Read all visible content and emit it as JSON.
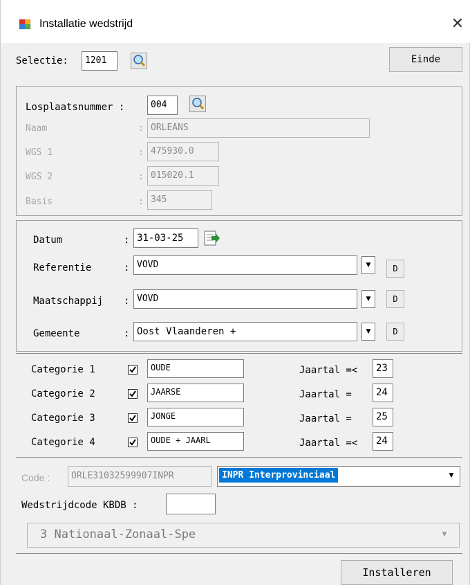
{
  "window": {
    "title": "Installatie wedstrijd",
    "close_glyph": "✕"
  },
  "top": {
    "selectie_label": "Selectie:",
    "selectie_value": "1201",
    "einde_label": "Einde"
  },
  "losplaats": {
    "nummer_label": "Losplaatsnummer :",
    "nummer_value": "004",
    "naam_label": "Naam",
    "naam_value": "ORLEANS",
    "wgs1_label": "WGS 1",
    "wgs1_value": "475930.0",
    "wgs2_label": "WGS 2",
    "wgs2_value": "015020.1",
    "basis_label": "Basis",
    "basis_value": "345",
    "colon": ":"
  },
  "details": {
    "datum_label": "Datum",
    "datum_value": "31-03-25",
    "referentie_label": "Referentie",
    "referentie_value": "VOVD",
    "maatschappij_label": "Maatschappij",
    "maatschappij_value": "VOVD",
    "gemeente_label": "Gemeente",
    "gemeente_value": "Oost Vlaanderen +",
    "colon": ":",
    "d_label": "D"
  },
  "categories": [
    {
      "label": "Categorie 1",
      "name": "OUDE",
      "jaartal_label": "Jaartal =<",
      "jaartal": "23",
      "checked": true
    },
    {
      "label": "Categorie 2",
      "name": "JAARSE",
      "jaartal_label": "Jaartal =",
      "jaartal": "24",
      "checked": true
    },
    {
      "label": "Categorie 3",
      "name": "JONGE",
      "jaartal_label": "Jaartal =",
      "jaartal": "25",
      "checked": true
    },
    {
      "label": "Categorie 4",
      "name": "OUDE + JAARL",
      "jaartal_label": "Jaartal =<",
      "jaartal": "24",
      "checked": true
    }
  ],
  "code": {
    "code_label": "Code :",
    "code_value": "ORLE31032599907INPR",
    "type_value": "INPR Interprovinciaal",
    "kbdb_label": "Wedstrijdcode KBDB :",
    "kbdb_value": "",
    "zone_value": "3 Nationaal-Zonaal-Spe"
  },
  "footer": {
    "installeren_label": "Installeren"
  },
  "colors": {
    "selection": "#0078d7",
    "accent_icon": "#2f8f3a"
  }
}
